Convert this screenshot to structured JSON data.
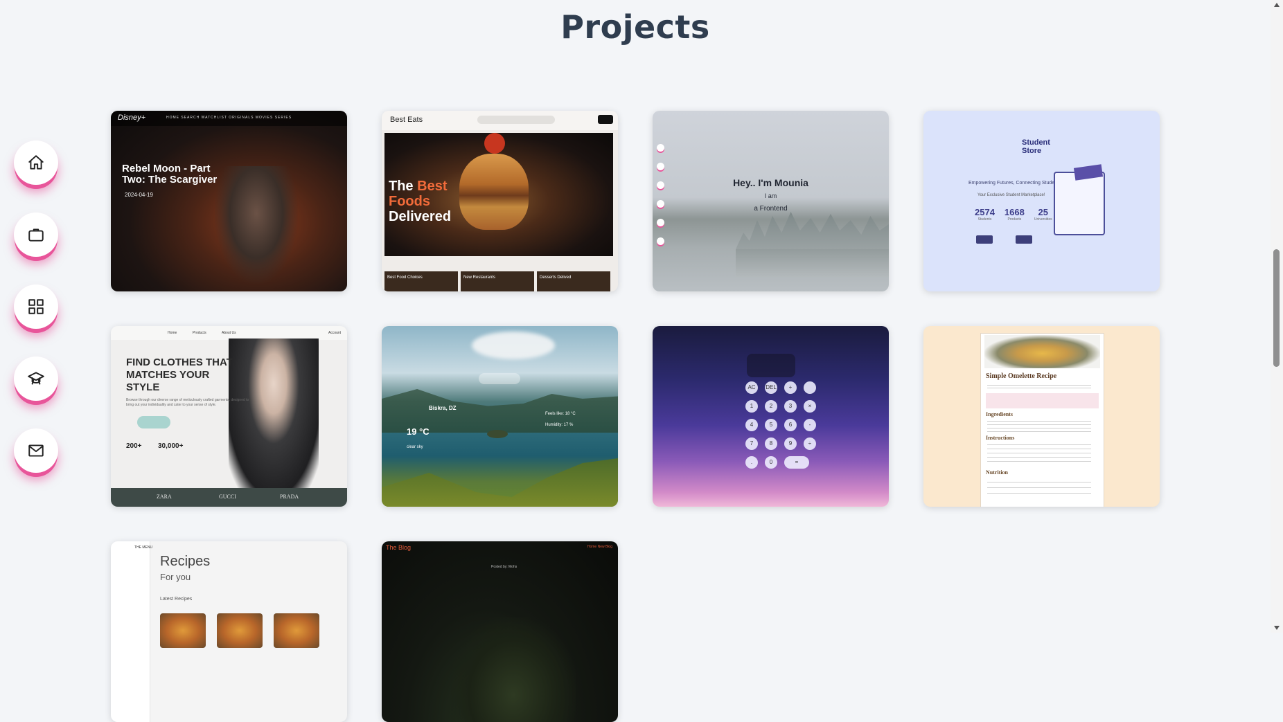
{
  "page": {
    "title": "Projects"
  },
  "side_nav": [
    {
      "name": "home",
      "icon": "home-icon"
    },
    {
      "name": "experience",
      "icon": "briefcase-icon"
    },
    {
      "name": "projects",
      "icon": "grid-icon"
    },
    {
      "name": "education",
      "icon": "graduation-cap-icon"
    },
    {
      "name": "contact",
      "icon": "mail-icon"
    }
  ],
  "cards": {
    "disney": {
      "logo": "Disney+",
      "menu": "HOME  SEARCH  WATCHLIST  ORIGINALS  MOVIES  SERIES",
      "title": "Rebel Moon - Part Two: The Scargiver",
      "date": "2024-04-19"
    },
    "best_eats": {
      "brand": "Best Eats",
      "hero_a": "The ",
      "hero_accent": "Best",
      "hero_b": "Foods",
      "hero_c": " Delivered",
      "tile1": "Best Food Choices",
      "tile2": "New Restaurants",
      "tile3": "Desserts Delived"
    },
    "portfolio": {
      "hey": "Hey.. I'm Mounia",
      "iam": "I am",
      "role": "a Frontend"
    },
    "student_store": {
      "logo": "Student Store",
      "tagline": "Empowering Futures, Connecting Students",
      "sub": "Your Exclusive Student Marketplace!",
      "stat1": "2574",
      "stat1_label": "Students",
      "stat2": "1668",
      "stat2_label": "Products",
      "stat3": "25",
      "stat3_label": "Universities"
    },
    "shop": {
      "nav_home": "Home",
      "nav_products": "Products",
      "nav_about": "About Us",
      "nav_account": "Account",
      "headline": "FIND CLOTHES THAT MATCHES YOUR STYLE",
      "sub": "Browse through our diverse range of meticulously crafted garments, designed to bring out your individuality and cater to your sense of style.",
      "n1": "200+",
      "n2": "30,000+",
      "brand1": "ZARA",
      "brand2": "GUCCI",
      "brand3": "PRADA"
    },
    "weather": {
      "city": "Biskra, DZ",
      "temp": "19 °C",
      "sky": "clear sky",
      "feels": "Feels like: 18 °C",
      "humidity": "Humidity: 17 %"
    },
    "calculator": {
      "keys": [
        "AC",
        "DEL",
        "+",
        "1",
        "2",
        "3",
        "×",
        "4",
        "5",
        "6",
        "-",
        "7",
        "8",
        "9",
        "÷",
        ".",
        "0",
        "="
      ]
    },
    "omelette": {
      "title": "Simple Omelette Recipe",
      "ingredients": "Ingredients",
      "instructions": "Instructions",
      "nutrition": "Nutrition"
    },
    "recipes": {
      "menu": "THE MENU",
      "title": "Recipes",
      "subtitle": "For you",
      "latest": "Latest Recipes"
    },
    "blog": {
      "name": "The Blog",
      "nav": "Home   New Blog",
      "by": "Posted by: Mohs"
    }
  }
}
